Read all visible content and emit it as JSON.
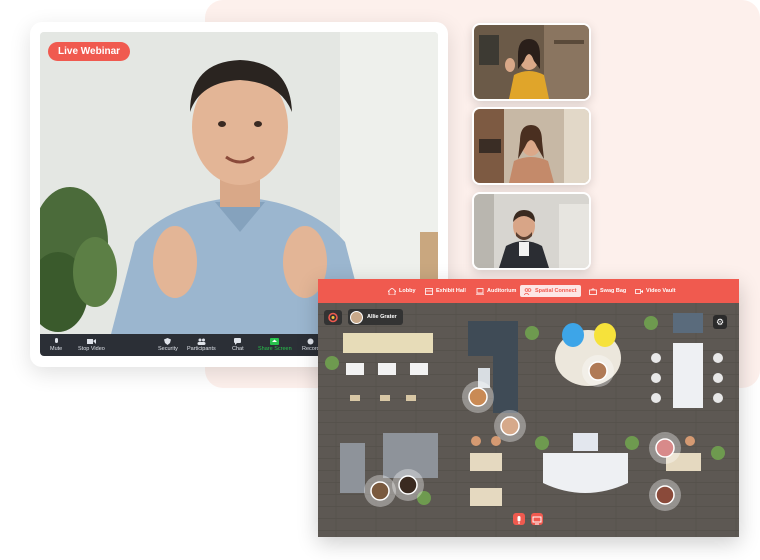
{
  "webinar": {
    "badge": "Live Webinar",
    "toolbar": [
      {
        "label": "Mute",
        "icon": "microphone-icon"
      },
      {
        "label": "Stop Video",
        "icon": "video-camera-icon"
      },
      {
        "label": "Security",
        "icon": "shield-icon"
      },
      {
        "label": "Participants",
        "icon": "people-icon"
      },
      {
        "label": "Chat",
        "icon": "chat-bubble-icon"
      },
      {
        "label": "Share Screen",
        "icon": "share-screen-icon",
        "color": "#27c24c"
      },
      {
        "label": "Record",
        "icon": "record-icon"
      }
    ]
  },
  "thumbnails": [
    {
      "name": "participant-1"
    },
    {
      "name": "participant-2"
    },
    {
      "name": "participant-3"
    }
  ],
  "map": {
    "nav": [
      {
        "label": "Lobby",
        "icon": "home-icon"
      },
      {
        "label": "Exhibit Hall",
        "icon": "exhibit-icon"
      },
      {
        "label": "Auditorium",
        "icon": "laptop-icon"
      },
      {
        "label": "Spatial Connect",
        "icon": "people-connect-icon",
        "active": true
      },
      {
        "label": "Swag Bag",
        "icon": "bag-icon"
      },
      {
        "label": "Video Vault",
        "icon": "video-icon"
      }
    ],
    "user_name": "Allie Grater"
  },
  "colors": {
    "accent": "#f05a4f",
    "share_green": "#27c24c",
    "toolbar_bg": "#2b2f36",
    "floor": "#5b5651"
  }
}
